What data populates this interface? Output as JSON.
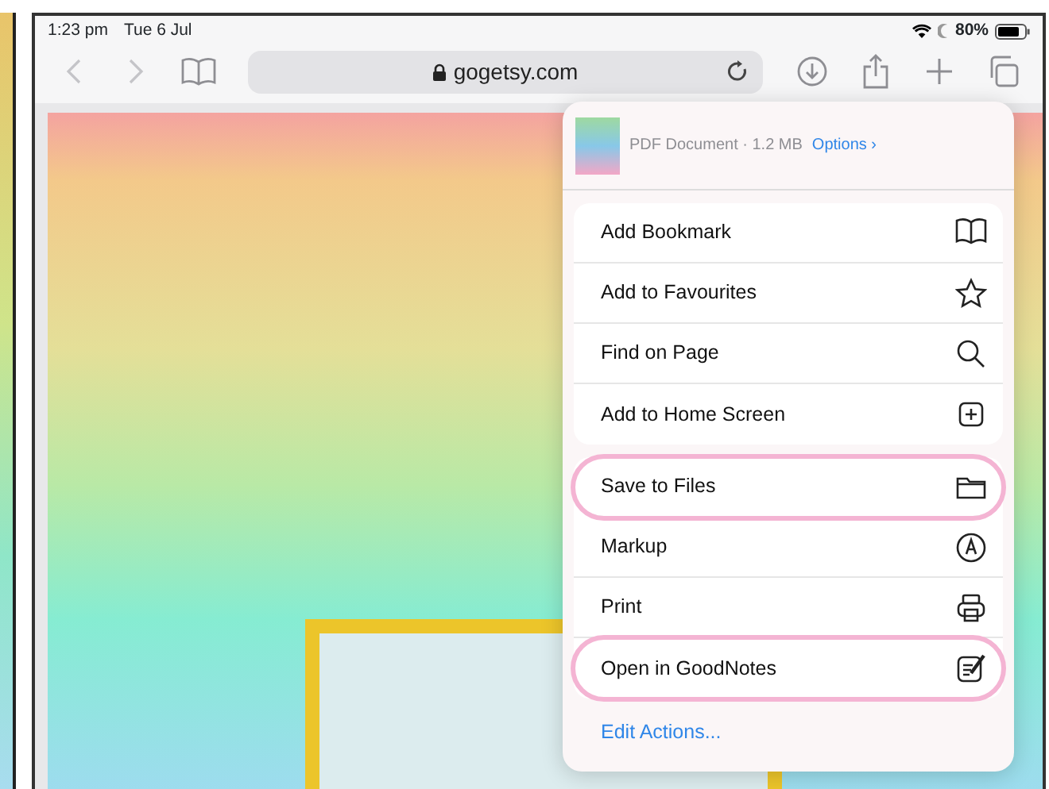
{
  "status_bar": {
    "time": "1:23 pm",
    "date": "Tue 6 Jul",
    "battery": "80%"
  },
  "toolbar": {
    "nav_buttons": [
      {
        "kind": "back",
        "disabled": true
      },
      {
        "kind": "forward",
        "disabled": true
      }
    ],
    "url": "gogetsy.com"
  },
  "share_sheet": {
    "file_info": "PDF Document · 1.2 MB",
    "options_link": "Options ›",
    "action_groups": [
      [
        {
          "label": "Add Bookmark",
          "highlighted": false
        },
        {
          "label": "Add to Favourites",
          "highlighted": false
        },
        {
          "label": "Find on Page",
          "highlighted": false
        },
        {
          "label": "Add to Home Screen",
          "highlighted": false
        }
      ],
      [
        {
          "label": "Save to Files",
          "highlighted": true
        },
        {
          "label": "Markup",
          "highlighted": false
        },
        {
          "label": "Print",
          "highlighted": false
        },
        {
          "label": "Open in GoodNotes",
          "highlighted": true
        }
      ]
    ],
    "edit_actions": "Edit Actions..."
  }
}
